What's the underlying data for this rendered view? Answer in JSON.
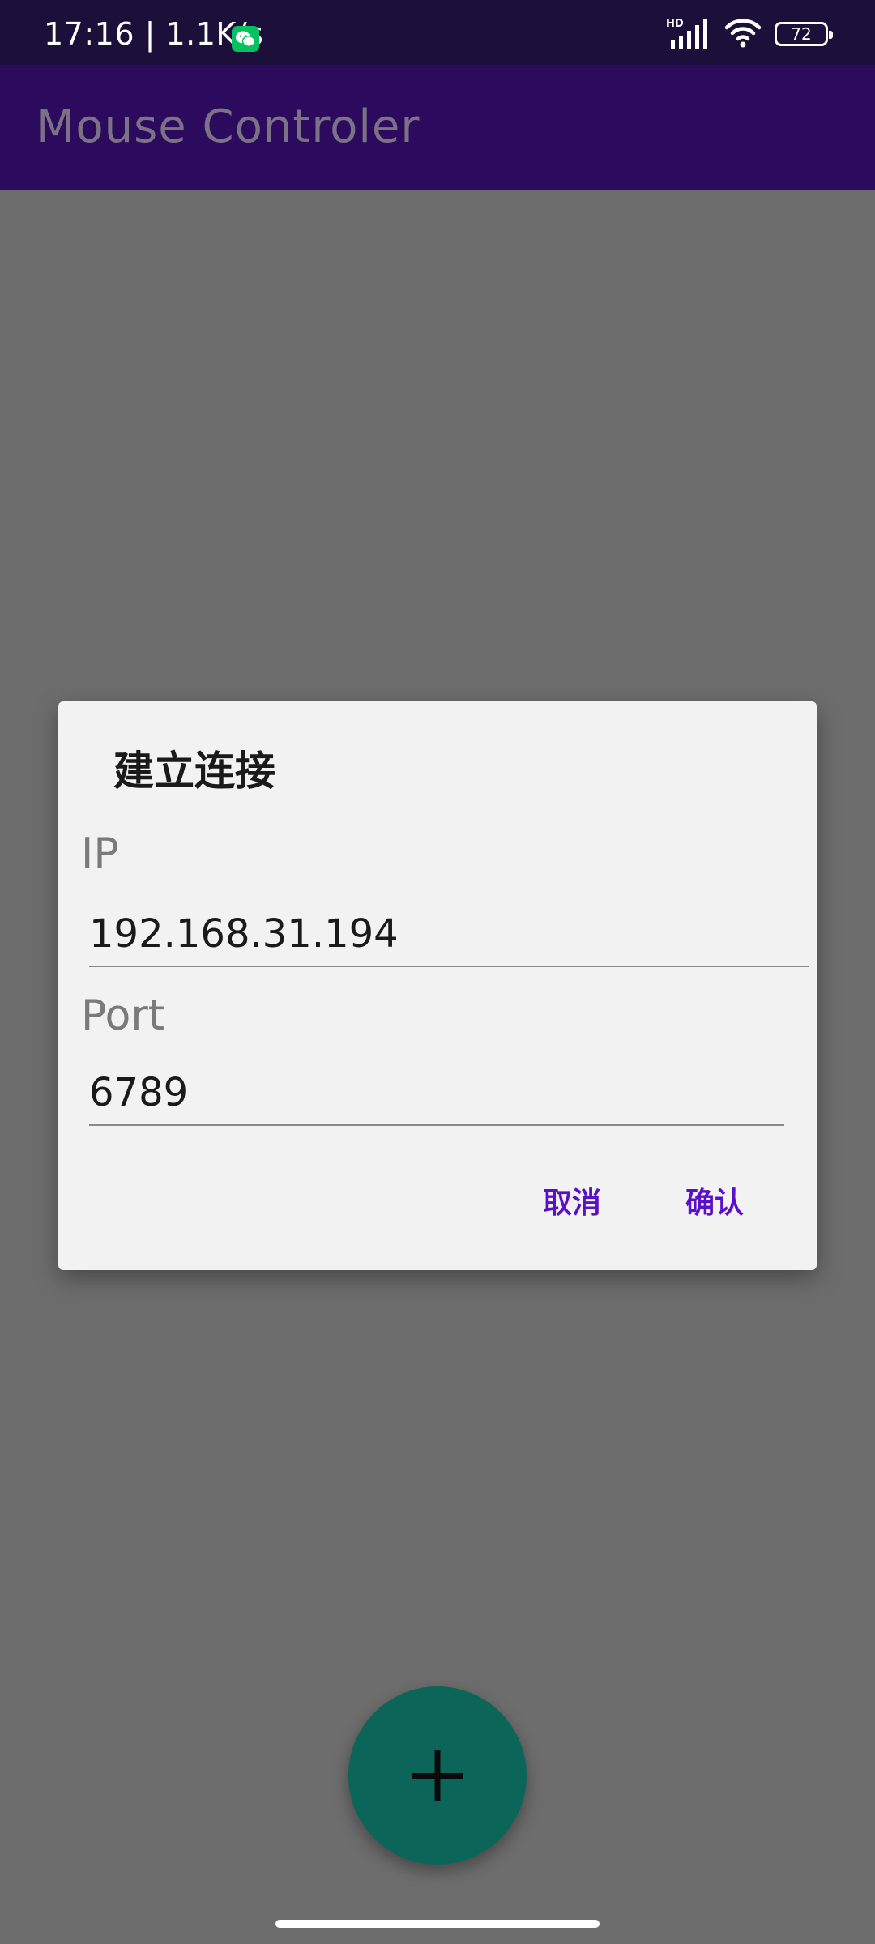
{
  "status_bar": {
    "time_speed": "17:16 | 1.1K/s",
    "network_badge": "HD",
    "battery": "72",
    "icons": [
      "wechat-icon",
      "signal-icon",
      "wifi-icon",
      "battery-icon"
    ]
  },
  "app_bar": {
    "title": "Mouse Controler"
  },
  "dialog": {
    "title": "建立连接",
    "ip": {
      "label": "IP",
      "value": "192.168.31.194"
    },
    "port": {
      "label": "Port",
      "value": "6789"
    },
    "cancel_label": "取消",
    "confirm_label": "确认"
  },
  "fab": {
    "icon": "plus-icon"
  },
  "colors": {
    "scrim": "#6d6d6d",
    "status_bar": "#1c0f3a",
    "app_bar": "#2c0a5e",
    "dialog_bg": "#f2f2f2",
    "accent": "#5a0fc8",
    "fab": "#0b6659",
    "wechat_green": "#07c160"
  }
}
